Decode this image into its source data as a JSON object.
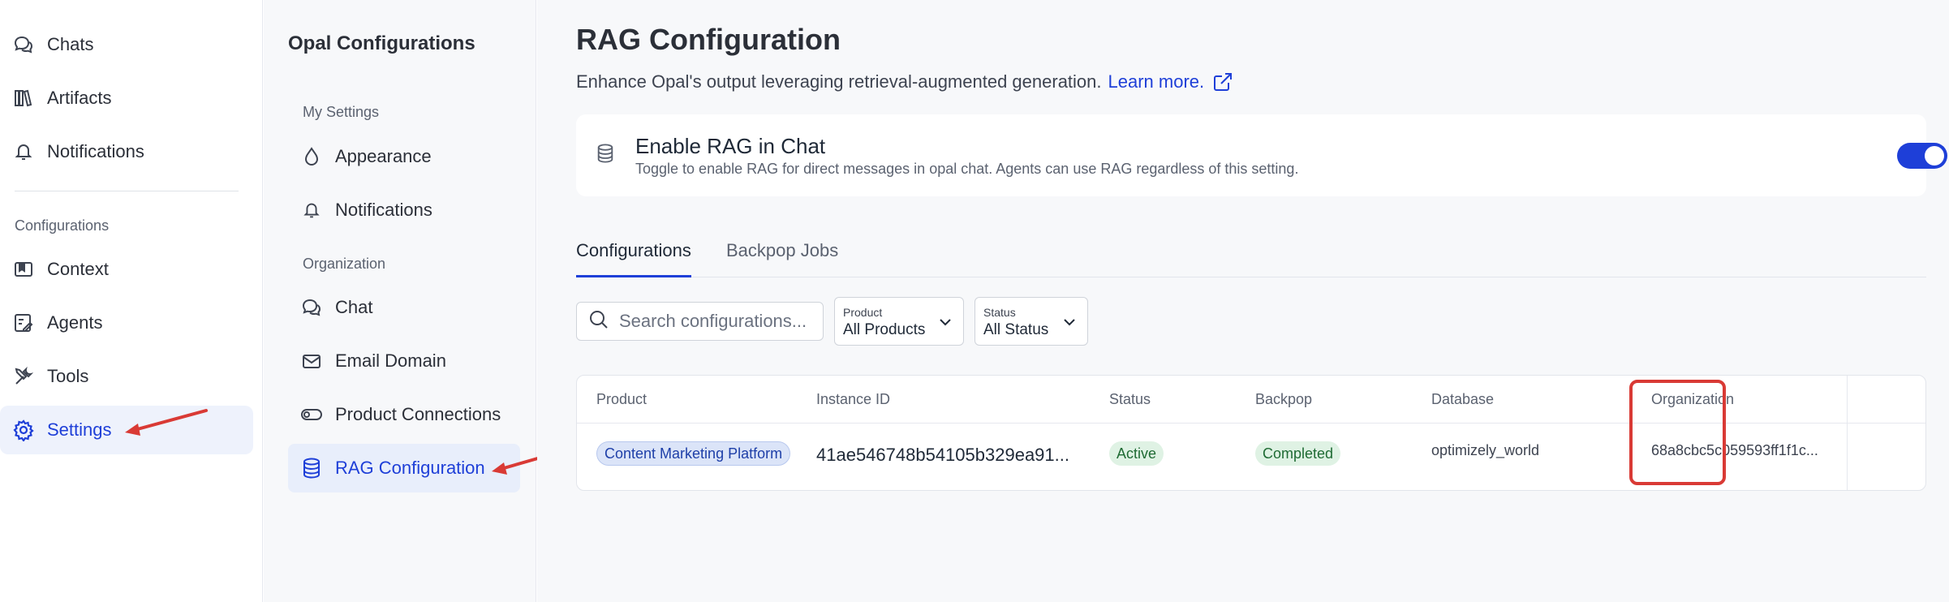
{
  "nav": {
    "items": [
      {
        "label": "Chats",
        "icon": "chats-icon"
      },
      {
        "label": "Artifacts",
        "icon": "artifacts-icon"
      },
      {
        "label": "Notifications",
        "icon": "bell-icon"
      }
    ],
    "section_label": "Configurations",
    "config_items": [
      {
        "label": "Context",
        "icon": "context-icon"
      },
      {
        "label": "Agents",
        "icon": "agents-icon"
      },
      {
        "label": "Tools",
        "icon": "tools-icon"
      },
      {
        "label": "Settings",
        "icon": "gear-icon",
        "active": true
      }
    ]
  },
  "subnav": {
    "title": "Opal Configurations",
    "section_my": "My Settings",
    "my_items": [
      {
        "label": "Appearance",
        "icon": "droplet-icon"
      },
      {
        "label": "Notifications",
        "icon": "bell-icon"
      }
    ],
    "section_org": "Organization",
    "org_items": [
      {
        "label": "Chat",
        "icon": "chat-icon"
      },
      {
        "label": "Email Domain",
        "icon": "mail-icon"
      },
      {
        "label": "Product Connections",
        "icon": "toggle-icon"
      },
      {
        "label": "RAG Configuration",
        "icon": "database-icon",
        "active": true
      }
    ]
  },
  "main": {
    "title": "RAG Configuration",
    "description": "Enhance Opal's output leveraging retrieval-augmented generation.",
    "learn_more": "Learn more.",
    "rag_card": {
      "title": "Enable RAG in Chat",
      "description": "Toggle to enable RAG for direct messages in opal chat. Agents can use RAG regardless of this setting.",
      "enabled": true
    },
    "tabs": [
      {
        "label": "Configurations",
        "active": true
      },
      {
        "label": "Backpop Jobs",
        "active": false
      }
    ],
    "search": {
      "placeholder": "Search configurations..."
    },
    "filters": {
      "product": {
        "label": "Product",
        "value": "All Products"
      },
      "status": {
        "label": "Status",
        "value": "All Status"
      }
    },
    "table": {
      "headers": [
        "Product",
        "Instance ID",
        "Status",
        "Backpop",
        "Database",
        "Organization"
      ],
      "rows": [
        {
          "product": "Content Marketing Platform",
          "instance_id": "41ae546748b54105b329ea91...",
          "status": "Active",
          "backpop": "Completed",
          "database": "optimizely_world",
          "organization": "68a8cbc5c059593ff1f1c..."
        }
      ]
    }
  },
  "colors": {
    "accent": "#1e3fd8",
    "annotation": "#d93a35",
    "active_bg": "#eef2fc"
  }
}
